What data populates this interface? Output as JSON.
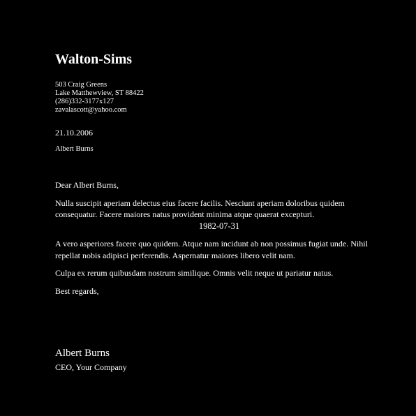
{
  "letter": {
    "company": "Walton-Sims",
    "address": {
      "street": "503 Craig Greens",
      "city": "Lake Matthewview, ST 88422",
      "phone": "(286)332-3177x127",
      "email": "zavalascott@yahoo.com"
    },
    "date": "21.10.2006",
    "recipient": "Albert Burns",
    "salutation": "Dear Albert Burns,",
    "paragraphs": [
      "Nulla suscipit aperiam delectus eius facere facilis. Nesciunt aperiam doloribus quidem consequatur. Facere maiores natus provident minima atque quaerat excepturi.",
      "A vero asperiores facere quo quidem. Atque nam incidunt ab non possimus fugiat unde. Nihil repellat nobis adipisci perferendis. Aspernatur maiores libero velit nam.",
      "Culpa ex rerum quibusdam nostrum similique. Omnis velit neque ut pariatur natus."
    ],
    "inline_date": "1982-07-31",
    "closing": "Best regards,",
    "signature": {
      "name": "Albert Burns",
      "title": "CEO, Your Company"
    }
  },
  "colors": {
    "background": "#000000",
    "text": "#ffffff"
  }
}
